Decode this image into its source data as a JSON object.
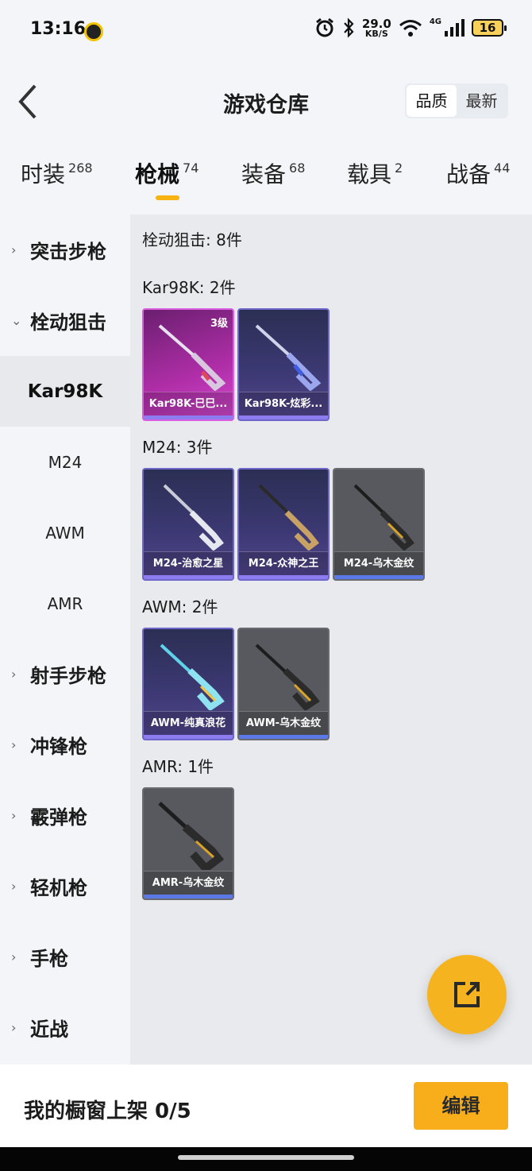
{
  "status_bar": {
    "time": "13:16",
    "speed_value": "29.0",
    "speed_unit": "KB/S",
    "network": "4G",
    "battery": "16"
  },
  "header": {
    "title": "游戏仓库",
    "sort_options": [
      "品质",
      "最新"
    ],
    "active_sort": "品质"
  },
  "category_tabs": [
    {
      "label": "时装",
      "count": "268"
    },
    {
      "label": "枪械",
      "count": "74",
      "active": true
    },
    {
      "label": "装备",
      "count": "68"
    },
    {
      "label": "载具",
      "count": "2"
    },
    {
      "label": "战备",
      "count": "44"
    }
  ],
  "sidebar": {
    "items": [
      {
        "label": "突击步枪",
        "type": "category"
      },
      {
        "label": "栓动狙击",
        "type": "category",
        "expanded": true
      },
      {
        "label": "Kar98K",
        "type": "sub",
        "selected": true
      },
      {
        "label": "M24",
        "type": "sub"
      },
      {
        "label": "AWM",
        "type": "sub"
      },
      {
        "label": "AMR",
        "type": "sub"
      },
      {
        "label": "射手步枪",
        "type": "category"
      },
      {
        "label": "冲锋枪",
        "type": "category"
      },
      {
        "label": "霰弹枪",
        "type": "category"
      },
      {
        "label": "轻机枪",
        "type": "category"
      },
      {
        "label": "手枪",
        "type": "category"
      },
      {
        "label": "近战",
        "type": "category"
      }
    ]
  },
  "main": {
    "heading": "栓动狙击: 8件",
    "groups": [
      {
        "title": "Kar98K: 2件",
        "items": [
          {
            "name": "Kar98K-巳巳...",
            "rarity": "pink",
            "badge": "3级"
          },
          {
            "name": "Kar98K-炫彩...",
            "rarity": "purple"
          }
        ]
      },
      {
        "title": "M24: 3件",
        "items": [
          {
            "name": "M24-治愈之星",
            "rarity": "purple"
          },
          {
            "name": "M24-众神之王",
            "rarity": "purple"
          },
          {
            "name": "M24-乌木金纹",
            "rarity": "gray"
          }
        ]
      },
      {
        "title": "AWM: 2件",
        "items": [
          {
            "name": "AWM-纯真浪花",
            "rarity": "purple"
          },
          {
            "name": "AWM-乌木金纹",
            "rarity": "gray"
          }
        ]
      },
      {
        "title": "AMR: 1件",
        "items": [
          {
            "name": "AMR-乌木金纹",
            "rarity": "gray"
          }
        ]
      }
    ]
  },
  "bottom": {
    "showcase_label": "我的橱窗上架 0/5",
    "edit_button": "编辑"
  },
  "colors": {
    "accent": "#f6b312",
    "rarity_purple": "#53478e",
    "rarity_pink": "#b02ea8",
    "rarity_gray": "#58595f"
  },
  "icons": {
    "back": "chevron-left-icon",
    "share": "external-link-icon",
    "sidebar_expand": "chevron-right-icon",
    "sidebar_collapse": "chevron-down-icon"
  }
}
